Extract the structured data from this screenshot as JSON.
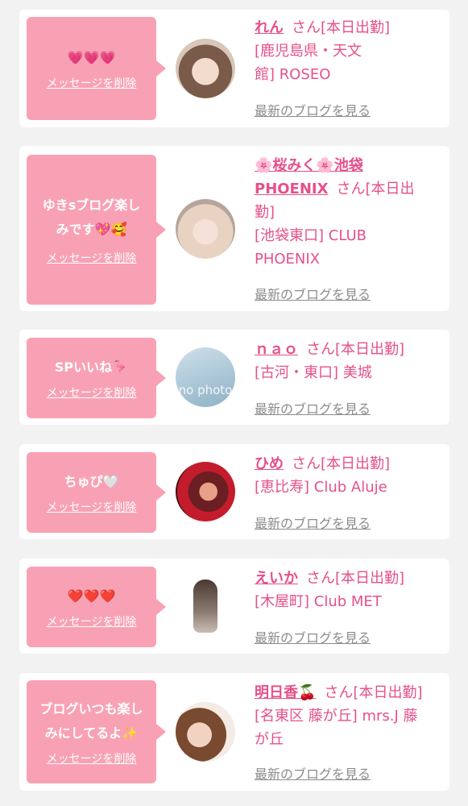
{
  "delete_label": "メッセージを削除",
  "blog_label": "最新のブログを見る",
  "san_suffix": "さん[本日出勤]",
  "no_photo_text": "no photo",
  "items": [
    {
      "message": "💗💗💗",
      "name": "れん",
      "shop_line1": "[鹿児島県・天文",
      "shop_line2": "館] ROSEO"
    },
    {
      "message_line1": "ゆきsブログ楽し",
      "message_line2": "みです💖🥰",
      "name_line1": "🌸桜みく🌸池袋",
      "name_line2": "PHOENIX",
      "san_line1": "さん[本日出",
      "san_line2": "勤]",
      "shop_line1": "[池袋東口] CLUB",
      "shop_line2": "PHOENIX"
    },
    {
      "message": "SPいいね🦩",
      "name": "ｎａｏ",
      "shop": "[古河・東口] 美城"
    },
    {
      "message": "ちゅぴ🤍",
      "name": "ひめ",
      "shop": "[恵比寿] Club Aluje"
    },
    {
      "message": "❤️❤️❤️",
      "name": "えいか",
      "shop": "[木屋町] Club MET"
    },
    {
      "message_line1": "ブログいつも楽し",
      "message_line2": "みにしてるよ✨",
      "name": "明日香🍒",
      "shop_line1": "[名東区 藤が丘] mrs.J 藤",
      "shop_line2": "が丘"
    }
  ]
}
